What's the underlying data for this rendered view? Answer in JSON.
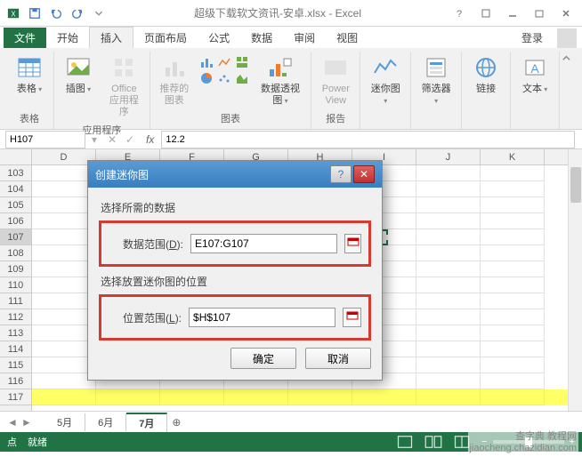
{
  "title": "超级下载软文资讯-安卓.xlsx - Excel",
  "tabs": {
    "file": "文件",
    "home": "开始",
    "insert": "插入",
    "layout": "页面布局",
    "formulas": "公式",
    "data": "数据",
    "review": "审阅",
    "view": "视图",
    "login": "登录"
  },
  "ribbon": {
    "tables": {
      "btn": "表格",
      "group": "表格"
    },
    "illus": {
      "pic": "插图",
      "office": "Office\n应用程序",
      "group": "应用程序"
    },
    "charts": {
      "rec": "推荐的\n图表",
      "pivot": "数据透视图",
      "group": "图表"
    },
    "reports": {
      "power": "Power\nView",
      "group": "报告"
    },
    "spark": {
      "btn": "迷你图",
      "group": ""
    },
    "filter": {
      "btn": "筛选器",
      "group": ""
    },
    "link": {
      "btn": "链接",
      "group": ""
    },
    "text": {
      "btn": "文本",
      "group": ""
    }
  },
  "namebox": "H107",
  "formula": "12.2",
  "fx_label": "fx",
  "cols": [
    "D",
    "E",
    "F",
    "G",
    "H",
    "I",
    "J",
    "K"
  ],
  "rows": [
    "103",
    "104",
    "105",
    "106",
    "107",
    "108",
    "109",
    "110",
    "111",
    "112",
    "113",
    "114",
    "115",
    "116",
    "117"
  ],
  "sheets": {
    "s1": "5月",
    "s2": "6月",
    "s3": "7月",
    "plus": "⊕"
  },
  "status": {
    "mode": "点",
    "ready": "就绪"
  },
  "dialog": {
    "title": "创建迷你图",
    "help": "?",
    "close": "✕",
    "sec1": "选择所需的数据",
    "field1_label_pre": "数据范围(",
    "field1_hot": "D",
    "field1_label_post": "):",
    "field1_value": "E107:G107",
    "sec2": "选择放置迷你图的位置",
    "field2_label_pre": "位置范围(",
    "field2_hot": "L",
    "field2_label_post": "):",
    "field2_value": "$H$107",
    "ok": "确定",
    "cancel": "取消"
  },
  "watermark": "jiaocheng.chazidian.com",
  "watermark2": "查字典 教程网"
}
